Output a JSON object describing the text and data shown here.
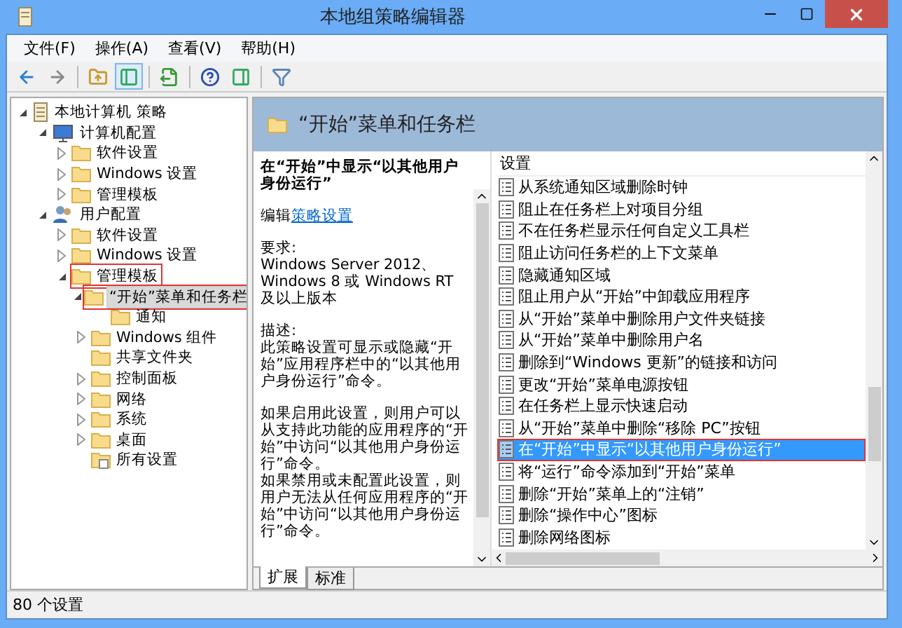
{
  "window": {
    "title": "本地组策略编辑器"
  },
  "menu": [
    "文件(F)",
    "操作(A)",
    "查看(V)",
    "帮助(H)"
  ],
  "toolbar": [
    {
      "kind": "back",
      "selected": false
    },
    {
      "kind": "forward",
      "selected": false
    },
    {
      "kind": "sep"
    },
    {
      "kind": "up",
      "selected": false
    },
    {
      "kind": "tree",
      "selected": true
    },
    {
      "kind": "sep"
    },
    {
      "kind": "export",
      "selected": false
    },
    {
      "kind": "sep"
    },
    {
      "kind": "help",
      "selected": false
    },
    {
      "kind": "panel",
      "selected": false
    },
    {
      "kind": "sep"
    },
    {
      "kind": "filter",
      "selected": false
    }
  ],
  "tree": [
    {
      "label": "本地计算机 策略",
      "kind": "policy",
      "expanded": true,
      "children": [
        {
          "label": "计算机配置",
          "kind": "computer",
          "expanded": true,
          "children": [
            {
              "label": "软件设置",
              "kind": "folder",
              "expanded": false,
              "has_children": true
            },
            {
              "label": "Windows 设置",
              "kind": "folder",
              "expanded": false,
              "has_children": true
            },
            {
              "label": "管理模板",
              "kind": "folder",
              "expanded": false,
              "has_children": true
            }
          ]
        },
        {
          "label": "用户配置",
          "kind": "user",
          "expanded": true,
          "children": [
            {
              "label": "软件设置",
              "kind": "folder",
              "expanded": false,
              "has_children": true
            },
            {
              "label": "Windows 设置",
              "kind": "folder",
              "expanded": false,
              "has_children": true
            },
            {
              "label": "管理模板",
              "kind": "folder",
              "expanded": true,
              "annotated": true,
              "children": [
                {
                  "label": "“开始”菜单和任务栏",
                  "kind": "folder",
                  "expanded": true,
                  "selected": true,
                  "annotated": true,
                  "children": [
                    {
                      "label": "通知",
                      "kind": "folder",
                      "expanded": false,
                      "has_children": false
                    }
                  ]
                },
                {
                  "label": "Windows 组件",
                  "kind": "folder",
                  "expanded": false,
                  "has_children": true
                },
                {
                  "label": "共享文件夹",
                  "kind": "folder",
                  "expanded": false,
                  "has_children": false
                },
                {
                  "label": "控制面板",
                  "kind": "folder",
                  "expanded": false,
                  "has_children": true
                },
                {
                  "label": "网络",
                  "kind": "folder",
                  "expanded": false,
                  "has_children": true
                },
                {
                  "label": "系统",
                  "kind": "folder",
                  "expanded": false,
                  "has_children": true
                },
                {
                  "label": "桌面",
                  "kind": "folder",
                  "expanded": false,
                  "has_children": true
                },
                {
                  "label": "所有设置",
                  "kind": "all",
                  "expanded": false,
                  "has_children": false
                }
              ]
            }
          ]
        }
      ]
    }
  ],
  "detail": {
    "heading": "“开始”菜单和任务栏",
    "title": "在“开始”中显示“以其他用户身份运行”",
    "edit_prefix": "编辑",
    "edit_link": "策略设置",
    "paragraphs": [
      "要求:",
      "Windows Server 2012、Windows 8 或 Windows RT 及以上版本",
      "描述:",
      "此策略设置可显示或隐藏“开始”应用程序栏中的“以其他用户身份运行”命令。",
      "如果启用此设置，则用户可以从支持此功能的应用程序的“开始”中访问“以其他用户身份运行”命令。",
      "如果禁用或未配置此设置，则用户无法从任何应用程序的“开始”中访问“以其他用户身份运行”命令。"
    ]
  },
  "settings": {
    "column": "设置",
    "rows": [
      {
        "label": "从系统通知区域删除时钟",
        "selected": false
      },
      {
        "label": "阻止在任务栏上对项目分组",
        "selected": false
      },
      {
        "label": "不在任务栏显示任何自定义工具栏",
        "selected": false
      },
      {
        "label": "阻止访问任务栏的上下文菜单",
        "selected": false
      },
      {
        "label": "隐藏通知区域",
        "selected": false
      },
      {
        "label": "阻止用户从“开始”中卸载应用程序",
        "selected": false
      },
      {
        "label": "从“开始”菜单中删除用户文件夹链接",
        "selected": false
      },
      {
        "label": "从“开始”菜单中删除用户名",
        "selected": false
      },
      {
        "label": "删除到“Windows 更新”的链接和访问",
        "selected": false
      },
      {
        "label": "更改“开始”菜单电源按钮",
        "selected": false
      },
      {
        "label": "在任务栏上显示快速启动",
        "selected": false
      },
      {
        "label": "从“开始”菜单中删除“移除 PC”按钮",
        "selected": false
      },
      {
        "label": "在“开始”中显示“以其他用户身份运行”",
        "selected": true,
        "annotated": true
      },
      {
        "label": "将“运行”命令添加到“开始”菜单",
        "selected": false
      },
      {
        "label": "删除“开始”菜单上的“注销”",
        "selected": false
      },
      {
        "label": "删除“操作中心”图标",
        "selected": false
      },
      {
        "label": "删除网络图标",
        "selected": false
      }
    ]
  },
  "tabs": [
    {
      "label": "扩展",
      "selected": true
    },
    {
      "label": "标准",
      "selected": false
    }
  ],
  "status_bar": "80 个设置"
}
